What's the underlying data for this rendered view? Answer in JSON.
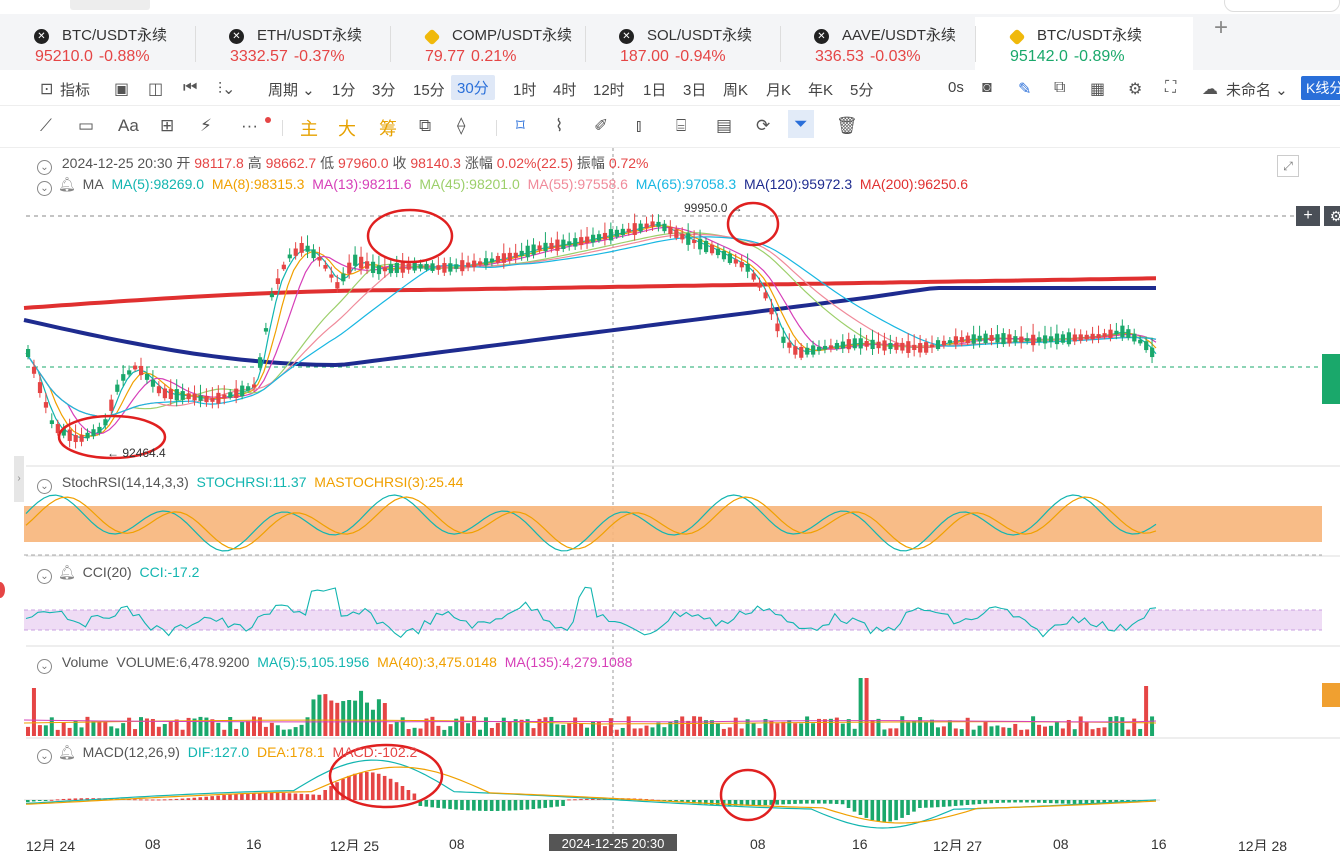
{
  "tabs": [
    {
      "icon": "x-coin-icon",
      "name": "BTC/USDT永续",
      "price": "95210.0",
      "change": "-0.88%",
      "active": false
    },
    {
      "icon": "x-coin-icon",
      "name": "ETH/USDT永续",
      "price": "3332.57",
      "change": "-0.37%",
      "active": false
    },
    {
      "icon": "binance-icon",
      "name": "COMP/USDT永续",
      "price": "79.77",
      "change": "0.21%",
      "active": false
    },
    {
      "icon": "x-coin-icon",
      "name": "SOL/USDT永续",
      "price": "187.00",
      "change": "-0.94%",
      "active": false
    },
    {
      "icon": "x-coin-icon",
      "name": "AAVE/USDT永续",
      "price": "336.53",
      "change": "-0.03%",
      "active": false
    },
    {
      "icon": "binance-icon",
      "name": "BTC/USDT永续",
      "price": "95142.0",
      "change": "-0.89%",
      "active": true
    }
  ],
  "toolbar": {
    "indicator_label": "指标",
    "period_label": "周期",
    "timeframes": [
      "1分",
      "3分",
      "15分",
      "30分",
      "1时",
      "4时",
      "12时",
      "1日",
      "3日",
      "周K",
      "月K",
      "年K",
      "5分"
    ],
    "selected_timeframe": "30分",
    "countdown": "0s",
    "layout_name": "未命名",
    "kline_label": "K线分"
  },
  "drawbar": {
    "text_tool": "Aa",
    "main_label": "主",
    "main_label2": "大",
    "chip_label": "筹"
  },
  "ohlc": {
    "time": "2024-12-25 20:30",
    "open_label": "开",
    "open": "98117.8",
    "high_label": "高",
    "high": "98662.7",
    "low_label": "低",
    "low": "97960.0",
    "close_label": "收",
    "close": "98140.3",
    "chg_label": "涨幅",
    "chg": "0.02%(22.5)",
    "amp_label": "振幅",
    "amp": "0.72%"
  },
  "ma": {
    "label": "MA",
    "ma5": "MA(5):98269.0",
    "ma8": "MA(8):98315.3",
    "ma13": "MA(13):98211.6",
    "ma45": "MA(45):98201.0",
    "ma55": "MA(55):97558.6",
    "ma65": "MA(65):97058.3",
    "ma120": "MA(120):95972.3",
    "ma200": "MA(200):96250.6"
  },
  "markers": {
    "high": "99950.0",
    "low": "92464.4"
  },
  "stochrsi": {
    "label": "StochRSI(14,14,3,3)",
    "k": "STOCHRSI:11.37",
    "d": "MASTOCHRSI(3):25.44"
  },
  "cci": {
    "label": "CCI(20)",
    "value": "CCI:-17.2"
  },
  "volume": {
    "label": "Volume",
    "value": "VOLUME:6,478.9200",
    "ma5": "MA(5):5,105.1956",
    "ma40": "MA(40):3,475.0148",
    "ma135": "MA(135):4,279.1088"
  },
  "macd": {
    "label": "MACD(12,26,9)",
    "dif": "DIF:127.0",
    "dea": "DEA:178.1",
    "macd": "MACD:-102.2"
  },
  "xaxis": {
    "crosshair": "2024-12-25 20:30",
    "ticks": [
      "12月 24",
      "08",
      "16",
      "12月 25",
      "08",
      "08",
      "16",
      "12月 27",
      "08",
      "16",
      "12月 28"
    ]
  },
  "colors": {
    "up": "#1aa86b",
    "down": "#e54545",
    "accent": "#2a6fd9",
    "ma120": "#1e2b8f",
    "ma200": "#e03030"
  }
}
